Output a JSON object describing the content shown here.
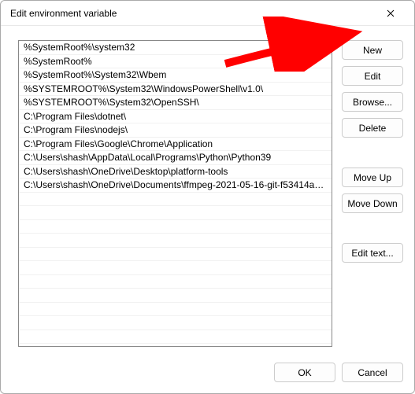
{
  "window": {
    "title": "Edit environment variable"
  },
  "paths": [
    "%SystemRoot%\\system32",
    "%SystemRoot%",
    "%SystemRoot%\\System32\\Wbem",
    "%SYSTEMROOT%\\System32\\WindowsPowerShell\\v1.0\\",
    "%SYSTEMROOT%\\System32\\OpenSSH\\",
    "C:\\Program Files\\dotnet\\",
    "C:\\Program Files\\nodejs\\",
    "C:\\Program Files\\Google\\Chrome\\Application",
    "C:\\Users\\shash\\AppData\\Local\\Programs\\Python\\Python39",
    "C:\\Users\\shash\\OneDrive\\Desktop\\platform-tools",
    "C:\\Users\\shash\\OneDrive\\Documents\\ffmpeg-2021-05-16-git-f53414a…"
  ],
  "buttons": {
    "new": "New",
    "edit": "Edit",
    "browse": "Browse...",
    "delete": "Delete",
    "moveup": "Move Up",
    "movedown": "Move Down",
    "edittext": "Edit text...",
    "ok": "OK",
    "cancel": "Cancel"
  },
  "annotation": {
    "arrow_color": "#ff0000",
    "arrow_target": "new-button"
  }
}
